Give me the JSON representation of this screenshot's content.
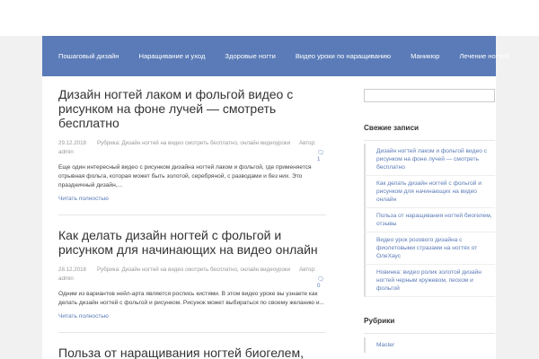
{
  "nav": {
    "items": [
      "Пошаговый дизайн",
      "Наращивание и уход",
      "Здоровые ногти",
      "Видео уроки по наращиванию",
      "Маникюр",
      "Лечение ногтей"
    ]
  },
  "posts": [
    {
      "title": "Дизайн ногтей лаком и фольгой видео с рисунком на фоне лучей — смотреть бесплатно",
      "date": "29.12.2018",
      "categories": "Рубрика: Дизайн ногтей на видео смотреть бесплатно, онлайн видеоуроки",
      "author_label": "Автор:",
      "author": "admin",
      "comments": "1",
      "excerpt": "Еще один интересный видео с рисунком дизайна ногтей лаком и фольгой, где применяется отрывная фольга, которая может быть золотой, серебряной, с разводами и без них. Это праздничный дизайн,...",
      "readmore": "Читать полностью"
    },
    {
      "title": "Как делать дизайн ногтей с фольгой и рисунком для начинающих на видео онлайн",
      "date": "28.12.2018",
      "categories": "Рубрика: Дизайн ногтей на видео смотреть бесплатно, онлайн видеоуроки",
      "author_label": "Автор:",
      "author": "admin",
      "comments": "0",
      "excerpt": "Одним из вариантов нейл-арта является роспись кистями. В этом видео уроке вы узнаете как делать дизайн ногтей с фольгой и рисунком. Рисунок может выбираться по своему желанию и...",
      "readmore": "Читать полностью"
    },
    {
      "title": "Польза от наращивания ногтей биогелем, отзывы"
    }
  ],
  "sidebar": {
    "recent_title": "Свежие записи",
    "recent": [
      "Дизайн ногтей лаком и фольгой видео с рисунком на фоне лучей — смотреть бесплатно",
      "Как делать дизайн ногтей с фольгой и рисунком для начинающих на видео онлайн",
      "Польза от наращивания ногтей биогелем, отзывы",
      "Видео урок розового дизайна с фиолетовыми стразами на ногтях от ОлеХаус",
      "Новинка: видео ролик золотой дизайн ногтей черным кружевом, песком и фольгой"
    ],
    "categories_title": "Рубрики",
    "categories": [
      "Master"
    ]
  },
  "colors": {
    "accent": "#5a7bb7",
    "page_bg": "#f1f1f1"
  }
}
